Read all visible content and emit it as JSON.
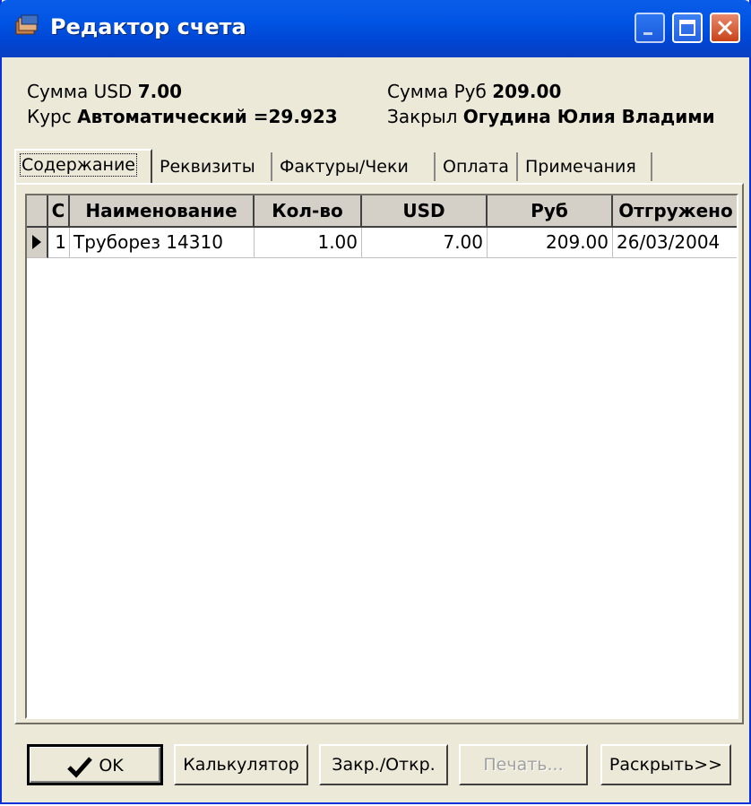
{
  "window": {
    "title": "Редактор счета",
    "icon": "books-app-icon"
  },
  "summary": {
    "usd_label": "Сумма USD",
    "usd_value": "7.00",
    "rub_label": "Сумма Руб",
    "rub_value": "209.00",
    "rate_label": "Курс",
    "rate_value": "Автоматический =29.923",
    "closed_label": "Закрыл",
    "closed_value": "Огудина Юлия Владими"
  },
  "tabs": [
    {
      "label": "Содержание",
      "active": true
    },
    {
      "label": "Реквизиты"
    },
    {
      "label": "Фактуры/Чеки"
    },
    {
      "label": "Оплата"
    },
    {
      "label": "Примечания"
    }
  ],
  "table": {
    "columns": [
      "С",
      "Наименование",
      "Кол-во",
      "USD",
      "Руб",
      "Отгружено"
    ],
    "rows": [
      {
        "c": "1",
        "name": "Труборез 14310",
        "qty": "1.00",
        "usd": "7.00",
        "rub": "209.00",
        "shipped": "26/03/2004"
      }
    ]
  },
  "buttons": {
    "ok": "OK",
    "calculator": "Калькулятор",
    "close_open": "Закр./Откр.",
    "print": "Печать...",
    "expand": "Раскрыть>>"
  }
}
